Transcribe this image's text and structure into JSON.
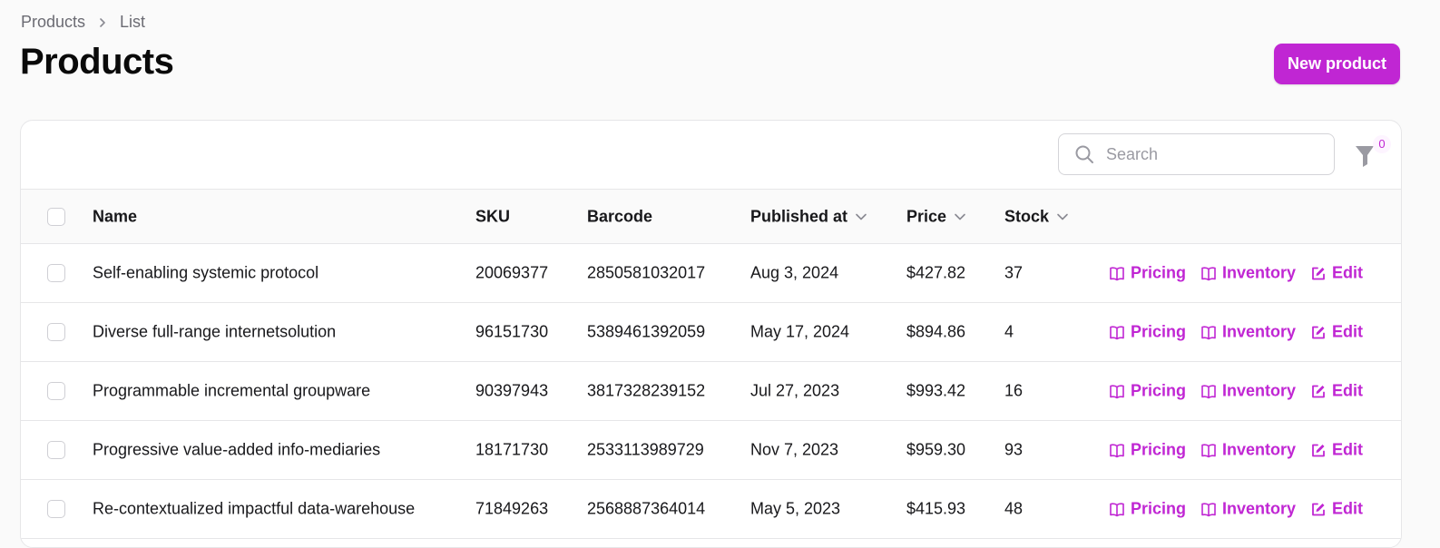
{
  "breadcrumb": {
    "parent": "Products",
    "current": "List"
  },
  "page_title": "Products",
  "new_button": "New product",
  "search": {
    "placeholder": "Search",
    "value": ""
  },
  "filter": {
    "count": "0"
  },
  "columns": {
    "name": "Name",
    "sku": "SKU",
    "barcode": "Barcode",
    "published_at": "Published at",
    "price": "Price",
    "stock": "Stock"
  },
  "actions": {
    "pricing": "Pricing",
    "inventory": "Inventory",
    "edit": "Edit"
  },
  "rows": [
    {
      "name": "Self-enabling systemic protocol",
      "sku": "20069377",
      "barcode": "2850581032017",
      "published_at": "Aug 3, 2024",
      "price": "$427.82",
      "stock": "37"
    },
    {
      "name": "Diverse full-range internetsolution",
      "sku": "96151730",
      "barcode": "5389461392059",
      "published_at": "May 17, 2024",
      "price": "$894.86",
      "stock": "4"
    },
    {
      "name": "Programmable incremental groupware",
      "sku": "90397943",
      "barcode": "3817328239152",
      "published_at": "Jul 27, 2023",
      "price": "$993.42",
      "stock": "16"
    },
    {
      "name": "Progressive value-added info-mediaries",
      "sku": "18171730",
      "barcode": "2533113989729",
      "published_at": "Nov 7, 2023",
      "price": "$959.30",
      "stock": "93"
    },
    {
      "name": "Re-contextualized impactful data-warehouse",
      "sku": "71849263",
      "barcode": "2568887364014",
      "published_at": "May 5, 2023",
      "price": "$415.93",
      "stock": "48"
    }
  ],
  "colors": {
    "accent": "#c026d3",
    "text": "#18181b",
    "muted": "#6b6b73",
    "border": "#e6e6e8"
  },
  "icons": {
    "breadcrumb_separator": "chevron-right-icon",
    "search": "search-icon",
    "filter": "funnel-icon",
    "sort": "chevron-down-icon",
    "pricing": "book-open-icon",
    "inventory": "book-open-icon",
    "edit": "pencil-square-icon"
  }
}
